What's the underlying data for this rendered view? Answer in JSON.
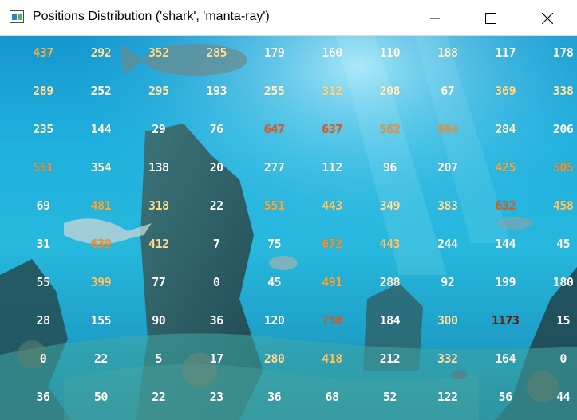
{
  "window": {
    "title": "Positions Distribution ('shark', 'manta-ray')",
    "icons": [
      "app-icon",
      "minimize-icon",
      "maximize-icon",
      "close-icon"
    ]
  },
  "heatmap": {
    "rows": [
      [
        "437",
        "292",
        "352",
        "285",
        "179",
        "160",
        "110",
        "188",
        "117",
        "178"
      ],
      [
        "289",
        "252",
        "295",
        "193",
        "255",
        "312",
        "208",
        "67",
        "369",
        "338"
      ],
      [
        "235",
        "144",
        "29",
        "76",
        "647",
        "637",
        "562",
        "584",
        "284",
        "206"
      ],
      [
        "551",
        "354",
        "138",
        "20",
        "277",
        "112",
        "96",
        "207",
        "425",
        "505"
      ],
      [
        "69",
        "481",
        "318",
        "22",
        "551",
        "443",
        "349",
        "383",
        "632",
        "458"
      ],
      [
        "31",
        "639",
        "412",
        "7",
        "75",
        "672",
        "443",
        "244",
        "144",
        "45"
      ],
      [
        "55",
        "399",
        "77",
        "0",
        "45",
        "491",
        "288",
        "92",
        "199",
        "180"
      ],
      [
        "28",
        "155",
        "90",
        "36",
        "120",
        "738",
        "184",
        "300",
        "1173",
        "15"
      ],
      [
        "0",
        "22",
        "5",
        "17",
        "280",
        "418",
        "212",
        "332",
        "164",
        "0"
      ],
      [
        "36",
        "50",
        "22",
        "23",
        "36",
        "68",
        "52",
        "122",
        "56",
        "44"
      ]
    ],
    "colors": [
      [
        "#f7b342",
        "#fce3a4",
        "#fddc8a",
        "#fce0a0",
        "#ffffff",
        "#ffffff",
        "#ffffff",
        "#fff2d0",
        "#ffffff",
        "#ffffff"
      ],
      [
        "#fce0a0",
        "#ffffff",
        "#fde6b0",
        "#ffffff",
        "#fff0cc",
        "#fcd88c",
        "#fff0cc",
        "#ffffff",
        "#fddc8a",
        "#fde6b0"
      ],
      [
        "#fff0cc",
        "#ffffff",
        "#ffffff",
        "#ffffff",
        "#e8571a",
        "#e8571a",
        "#f29130",
        "#f29130",
        "#fff0cc",
        "#ffffff"
      ],
      [
        "#f29130",
        "#fff0cc",
        "#ffffff",
        "#ffffff",
        "#ffffff",
        "#ffffff",
        "#ffffff",
        "#ffffff",
        "#f7a93c",
        "#f29130"
      ],
      [
        "#ffffff",
        "#f7a93c",
        "#fddc8a",
        "#ffffff",
        "#f7a93c",
        "#fcc96a",
        "#fce0a0",
        "#fce0a0",
        "#e05a18",
        "#fcc96a"
      ],
      [
        "#ffffff",
        "#f29130",
        "#fcd88c",
        "#ffffff",
        "#ffffff",
        "#f29130",
        "#fcc96a",
        "#ffffff",
        "#ffffff",
        "#ffffff"
      ],
      [
        "#ffffff",
        "#fcc96a",
        "#ffffff",
        "#ffffff",
        "#ffffff",
        "#f7a93c",
        "#fff0cc",
        "#ffffff",
        "#ffffff",
        "#ffffff"
      ],
      [
        "#ffffff",
        "#ffffff",
        "#ffffff",
        "#ffffff",
        "#ffffff",
        "#e8571a",
        "#ffffff",
        "#fce0a0",
        "#6b1a05",
        "#ffffff"
      ],
      [
        "#ffffff",
        "#ffffff",
        "#ffffff",
        "#ffffff",
        "#fce0a0",
        "#fcc96a",
        "#ffffff",
        "#fce0a0",
        "#ffffff",
        "#ffffff"
      ],
      [
        "#ffffff",
        "#ffffff",
        "#ffffff",
        "#ffffff",
        "#ffffff",
        "#ffffff",
        "#ffffff",
        "#ffffff",
        "#ffffff",
        "#ffffff"
      ]
    ]
  }
}
